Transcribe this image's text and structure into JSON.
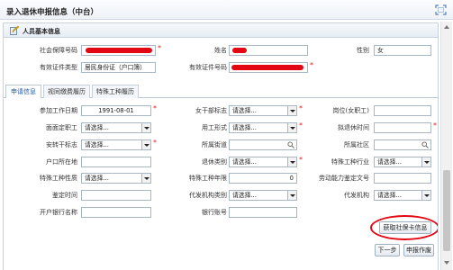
{
  "window": {
    "title": "录入退休申报信息（中台）",
    "maximize_icon": "maximize-icon"
  },
  "section": {
    "title": "人员基本信息",
    "icon": "edit-icon"
  },
  "basic": {
    "ss_number_label": "社会保障号码",
    "name_label": "姓名",
    "gender_label": "性别",
    "gender_value": "女",
    "id_type_label": "有效证件类型",
    "id_type_value": "居民身份证（户口簿）",
    "id_number_label": "有效证件号码"
  },
  "tabs": [
    "申请信息",
    "视同缴费履历",
    "特殊工种履历"
  ],
  "form": {
    "work_start_label": "参加工作日期",
    "work_start_value": "1991-08-01",
    "female_cadre_label": "女干部标志",
    "position_label": "岗位(女职工)",
    "face_label": "面面定职工",
    "employment_form_label": "用工形式",
    "proposed_retire_label": "拟退休时间",
    "transfer_label": "安转干标志",
    "street_label": "所属街道",
    "community_label": "所属社区",
    "hukou_label": "户口所在地",
    "retire_category_label": "退休类别",
    "special_industry_label": "特殊工种行业",
    "special_nature_label": "特殊工种性质",
    "special_years_label": "特殊工种年限",
    "special_years_value": "0",
    "labor_doc_label": "劳动能力鉴定文号",
    "appraisal_time_label": "鉴定时间",
    "agent_type_label": "代发机构类别",
    "agent_label": "代发机构",
    "bank_name_label": "开户银行名称",
    "bank_account_label": "银行账号",
    "placeholder": "请选择..."
  },
  "buttons": {
    "get_card": "获取社保卡信息",
    "next": "下一步",
    "declare": "申报作废"
  }
}
